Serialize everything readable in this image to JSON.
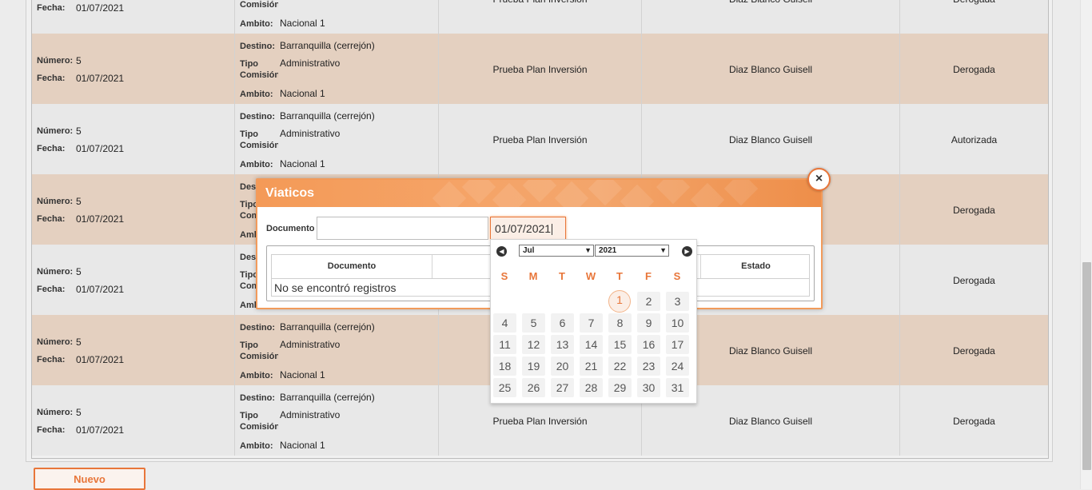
{
  "labels": {
    "numero": "Número:",
    "fecha": "Fecha:",
    "destino": "Destino:",
    "tipo": "Tipo",
    "comision": "Comisión",
    "ambito": "Ambito:"
  },
  "rows": [
    {
      "numero": "",
      "fecha": "01/07/2021",
      "destino": "",
      "tipo": "",
      "ambito": "Nacional 1",
      "plan": "Prueba Plan Inversión",
      "persona": "Diaz Blanco Guisell",
      "estado": "Derogada"
    },
    {
      "numero": "5",
      "fecha": "01/07/2021",
      "destino": "Barranquilla (cerrejón)",
      "tipo": "Administrativo",
      "ambito": "Nacional 1",
      "plan": "Prueba Plan Inversión",
      "persona": "Diaz Blanco Guisell",
      "estado": "Derogada"
    },
    {
      "numero": "5",
      "fecha": "01/07/2021",
      "destino": "Barranquilla (cerrejón)",
      "tipo": "Administrativo",
      "ambito": "Nacional 1",
      "plan": "Prueba Plan Inversión",
      "persona": "Diaz Blanco Guisell",
      "estado": "Autorizada"
    },
    {
      "numero": "5",
      "fecha": "01/07/2021",
      "destino": "",
      "tipo": "",
      "ambito": "",
      "plan": "",
      "persona": "",
      "estado": "Derogada"
    },
    {
      "numero": "5",
      "fecha": "01/07/2021",
      "destino": "",
      "tipo": "",
      "ambito": "",
      "plan": "",
      "persona": "",
      "estado": "Derogada"
    },
    {
      "numero": "5",
      "fecha": "01/07/2021",
      "destino": "Barranquilla (cerrejón)",
      "tipo": "Administrativo",
      "ambito": "Nacional 1",
      "plan": "",
      "persona": "Diaz Blanco Guisell",
      "estado": "Derogada"
    },
    {
      "numero": "5",
      "fecha": "01/07/2021",
      "destino": "Barranquilla (cerrejón)",
      "tipo": "Administrativo",
      "ambito": "Nacional 1",
      "plan": "Prueba Plan Inversión",
      "persona": "Diaz Blanco Guisell",
      "estado": "Derogada"
    }
  ],
  "buttons": {
    "nuevo": "Nuevo",
    "close_icon": "×"
  },
  "modal": {
    "title": "Viaticos",
    "documento_label": "Documento",
    "documento_value": "",
    "fecha_value": "01/07/2021",
    "table_headers": [
      "Documento",
      "",
      "",
      "Estado"
    ],
    "empty_message": "No se encontró registros"
  },
  "calendar": {
    "month": "Jul",
    "year": "2021",
    "weekdays": [
      "S",
      "M",
      "T",
      "W",
      "T",
      "F",
      "S"
    ],
    "selected_day": 1,
    "weeks": [
      [
        "",
        "",
        "",
        "",
        "1",
        "2",
        "3"
      ],
      [
        "4",
        "5",
        "6",
        "7",
        "8",
        "9",
        "10"
      ],
      [
        "11",
        "12",
        "13",
        "14",
        "15",
        "16",
        "17"
      ],
      [
        "18",
        "19",
        "20",
        "21",
        "22",
        "23",
        "24"
      ],
      [
        "25",
        "26",
        "27",
        "28",
        "29",
        "30",
        "31"
      ]
    ]
  },
  "colors": {
    "accent": "#e8763a",
    "row_even": "#e8e8e8",
    "row_odd": "#e4d0c0",
    "modal_header": "#f49a57"
  }
}
